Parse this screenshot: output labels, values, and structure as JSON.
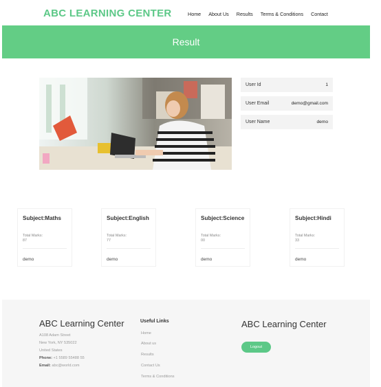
{
  "header": {
    "brand": "ABC LEARNING CENTER",
    "nav": [
      "Home",
      "About Us",
      "Results",
      "Terms & Conditions",
      "Contact"
    ]
  },
  "banner": {
    "title": "Result"
  },
  "user": {
    "rows": [
      {
        "label": "User Id",
        "value": "1"
      },
      {
        "label": "User Email",
        "value": "demo@gmail.com"
      },
      {
        "label": "User Name",
        "value": "demo"
      }
    ]
  },
  "subjects": [
    {
      "title": "Subject:Maths",
      "marks_label": "Total Marks:",
      "marks": "87",
      "name": "demo"
    },
    {
      "title": "Subject:English",
      "marks_label": "Total Marks:",
      "marks": "77",
      "name": "demo"
    },
    {
      "title": "Subject:Science",
      "marks_label": "Total Marks:",
      "marks": "00",
      "name": "demo"
    },
    {
      "title": "Subject:Hindi",
      "marks_label": "Total Marks:",
      "marks": "33",
      "name": "demo"
    }
  ],
  "footer": {
    "left_title": "ABC Learning Center",
    "address_lines": [
      "A108 Adam Street",
      "New York, NY 535022",
      "United States"
    ],
    "phone_label": "Phone:",
    "phone": "+1 5589 55488 55",
    "email_label": "Email:",
    "email": "abc@world.com",
    "links_title": "Useful Links",
    "links": [
      "Home",
      "About us",
      "Results",
      "Contact Us",
      "Terms & Conditions"
    ],
    "right_title": "ABC Learning Center",
    "logout_label": "Logout"
  },
  "colors": {
    "accent": "#5cc887",
    "banner": "#63cd85",
    "footer_bg": "#f6f6f6"
  }
}
